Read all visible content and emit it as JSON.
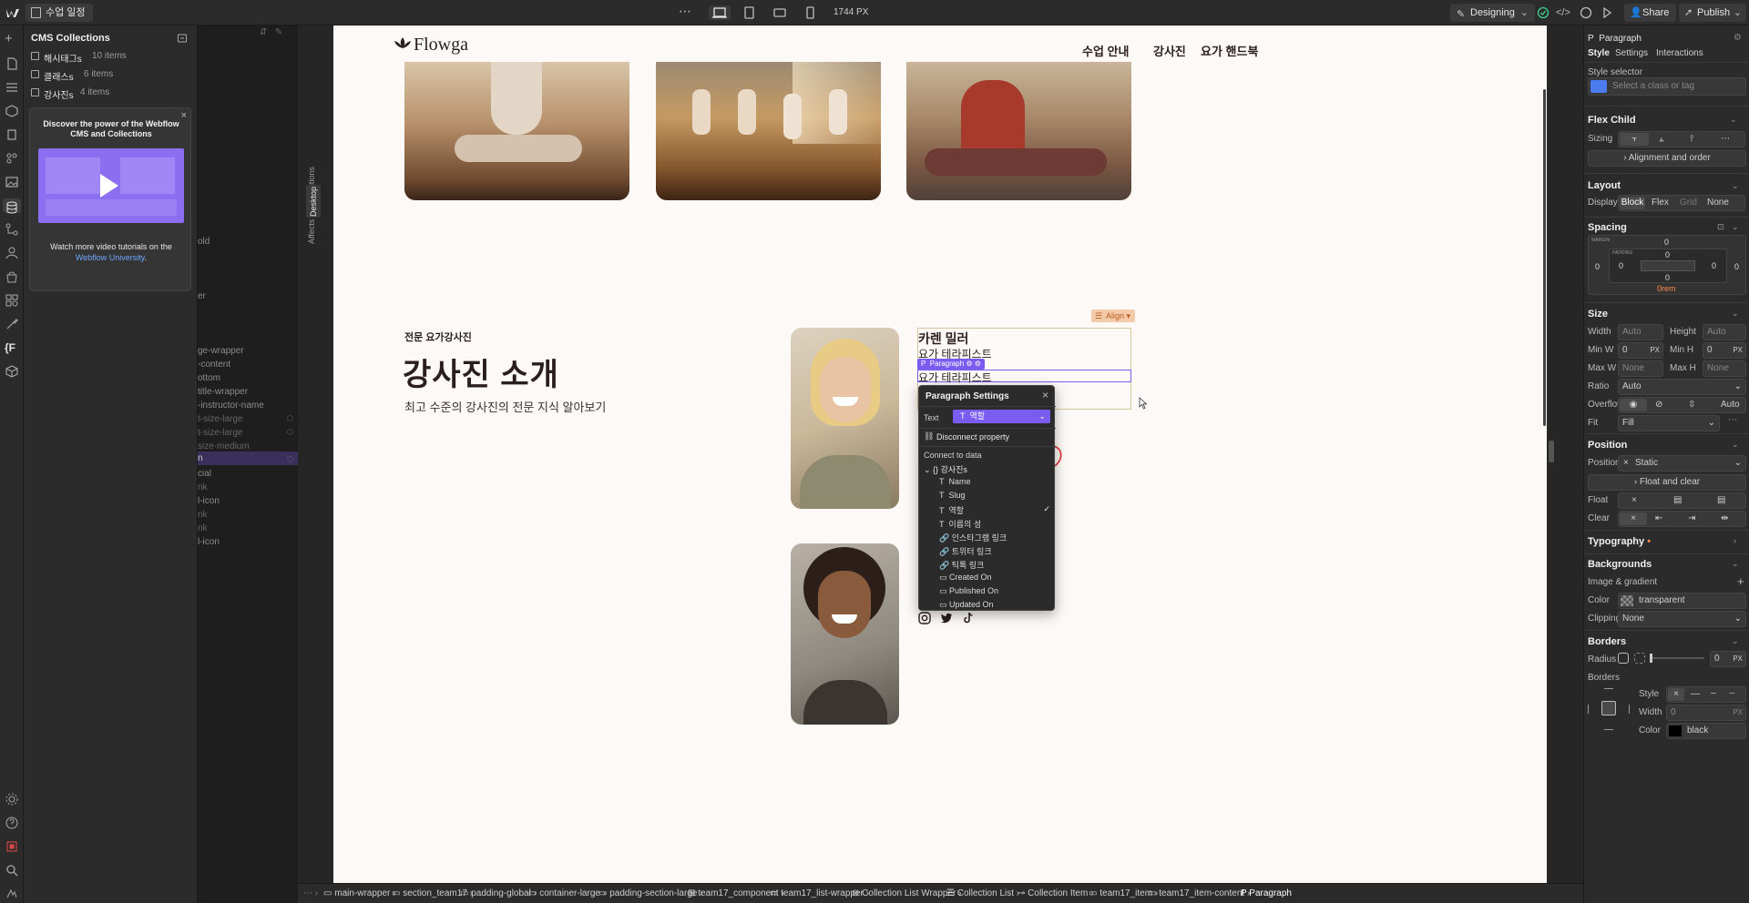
{
  "topbar": {
    "project_name": "수업 일정",
    "canvas_width": "1744 PX",
    "mode": "Designing",
    "share": "Share",
    "publish": "Publish"
  },
  "cms": {
    "title": "CMS Collections",
    "collections": [
      {
        "name": "해시태그s",
        "count": "10 items"
      },
      {
        "name": "클래스s",
        "count": "6 items"
      },
      {
        "name": "강사진s",
        "count": "4 items"
      }
    ],
    "promo_title": "Discover the power of the Webflow CMS and Collections",
    "promo_text": "Watch more video tutorials on the",
    "promo_link": "Webflow University",
    "promo_end": "."
  },
  "navigator_ghost": [
    "old",
    "er",
    "ge-wrapper",
    "-content",
    "ottom",
    "title-wrapper",
    "-instructor-name",
    "t-size-large",
    "t-size-large",
    "size-medium",
    "n",
    "cial",
    "nk",
    "l-icon",
    "nk",
    "nk",
    "l-icon"
  ],
  "canvas_side": {
    "affects": "Affects all resolutions",
    "breakpoint": "Desktop"
  },
  "site": {
    "logo": "Flowga",
    "nav": [
      "수업 안내",
      "강사진",
      "요가 핸드북"
    ],
    "eyebrow": "전문 요가강사진",
    "heading": "강사진 소개",
    "subheading": "최고 수준의 강사진의 전문 지식 알아보기",
    "instructor_name": "카렌 밀러",
    "instructor_role": "요가 테라피스트",
    "instructor_role_selected": "요가 테라피스트",
    "align_label": "Align",
    "selected_tag": "Paragraph"
  },
  "paragraph_settings": {
    "title": "Paragraph Settings",
    "text_label": "Text",
    "bound_field": "역할",
    "disconnect": "Disconnect property",
    "connect": "Connect to data",
    "collection": "강사진s",
    "fields": [
      "Name",
      "Slug",
      "역할",
      "이름의 성",
      "인스타그램 링크",
      "트위터 링크",
      "틱톡 링크",
      "Created On",
      "Published On",
      "Updated On"
    ],
    "selected_field": "역할"
  },
  "right_panel": {
    "element": "Paragraph",
    "tabs": [
      "Style",
      "Settings",
      "Interactions"
    ],
    "style_selector": "Style selector",
    "class_placeholder": "Select a class or tag",
    "flex_child": "Flex Child",
    "sizing": "Sizing",
    "align_order": "Alignment and order",
    "layout": "Layout",
    "display": "Display",
    "display_options": [
      "Block",
      "Flex",
      "Grid",
      "None"
    ],
    "spacing": "Spacing",
    "margin_label": "MARGIN",
    "padding_label": "PADDING",
    "margin": {
      "top": "0",
      "right": "0",
      "bottom": "0rem",
      "left": "0"
    },
    "padding": {
      "top": "0",
      "right": "0",
      "bottom": "0",
      "left": "0"
    },
    "size": "Size",
    "width": "Width",
    "width_val": "Auto",
    "height": "Height",
    "height_val": "Auto",
    "minw": "Min W",
    "minw_val": "0",
    "minh": "Min H",
    "minh_val": "0",
    "maxw": "Max W",
    "maxw_val": "None",
    "maxh": "Max H",
    "maxh_val": "None",
    "unit": "PX",
    "ratio": "Ratio",
    "ratio_val": "Auto",
    "overflow": "Overflow",
    "overflow_auto": "Auto",
    "fit": "Fit",
    "fit_val": "Fill",
    "position_h": "Position",
    "position": "Position",
    "position_val": "Static",
    "float_clear": "Float and clear",
    "float": "Float",
    "clear": "Clear",
    "typography": "Typography",
    "backgrounds": "Backgrounds",
    "image_gradient": "Image & gradient",
    "color": "Color",
    "color_val": "transparent",
    "clipping": "Clipping",
    "clipping_val": "None",
    "borders_h": "Borders",
    "radius": "Radius",
    "radius_val": "0",
    "borders": "Borders",
    "style": "Style",
    "bwidth": "Width",
    "bwidth_val": "0",
    "bcolor": "Color",
    "bcolor_val": "black"
  },
  "breadcrumbs": [
    "main-wrapper",
    "section_team17",
    "padding-global",
    "container-large",
    "padding-section-large",
    "team17_component",
    "team17_list-wrapper",
    "Collection List Wrapper",
    "Collection List",
    "Collection Item",
    "team17_item",
    "team17_item-content",
    "Paragraph"
  ],
  "colors": {
    "accent": "#4a7cf0",
    "selection": "#7b5cf0",
    "brand_text": "#2a1f1c",
    "canvas_bg": "#fdf9f6"
  }
}
